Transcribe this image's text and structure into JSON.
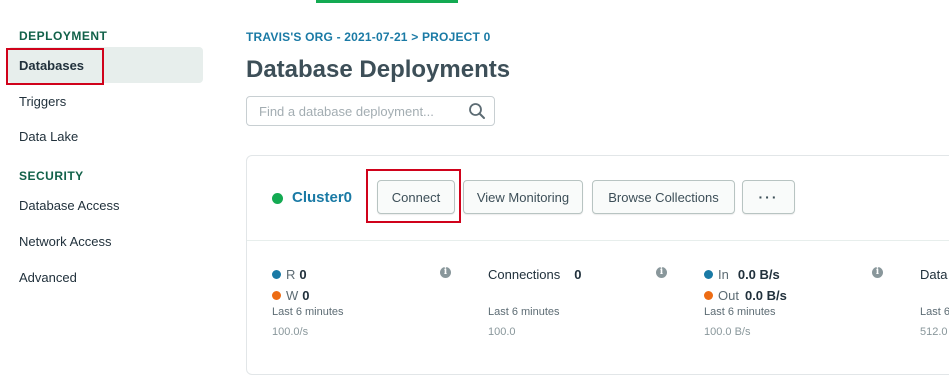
{
  "sidebar": {
    "deployment_title": "DEPLOYMENT",
    "deployment_items": [
      "Databases",
      "Triggers",
      "Data Lake"
    ],
    "security_title": "SECURITY",
    "security_items": [
      "Database Access",
      "Network Access",
      "Advanced"
    ],
    "active_item": "Databases"
  },
  "header": {
    "breadcrumb": "TRAVIS'S ORG - 2021-07-21 > PROJECT 0",
    "title": "Database Deployments"
  },
  "search": {
    "placeholder": "Find a database deployment...",
    "icon": "search-icon"
  },
  "cluster": {
    "name": "Cluster0",
    "status_color": "#13aa52",
    "buttons": {
      "connect": "Connect",
      "view_monitoring": "View Monitoring",
      "browse_collections": "Browse Collections",
      "more": "···"
    },
    "metrics": {
      "ops": {
        "r_label": "R",
        "r_value": "0",
        "w_label": "W",
        "w_value": "0",
        "period": "Last 6 minutes",
        "scale": "100.0/s"
      },
      "connections": {
        "label": "Connections",
        "value": "0",
        "period": "Last 6 minutes",
        "scale": "100.0"
      },
      "network": {
        "in_label": "In",
        "in_value": "0.0 B/s",
        "out_label": "Out",
        "out_value": "0.0 B/s",
        "period": "Last 6 minutes",
        "scale": "100.0 B/s"
      },
      "data": {
        "label": "Data",
        "period": "Last 6",
        "scale": "512.0"
      }
    }
  },
  "colors": {
    "accent": "#1a7aa5",
    "highlight": "#d0021b",
    "green": "#13aa52",
    "orange": "#ed6c14"
  }
}
